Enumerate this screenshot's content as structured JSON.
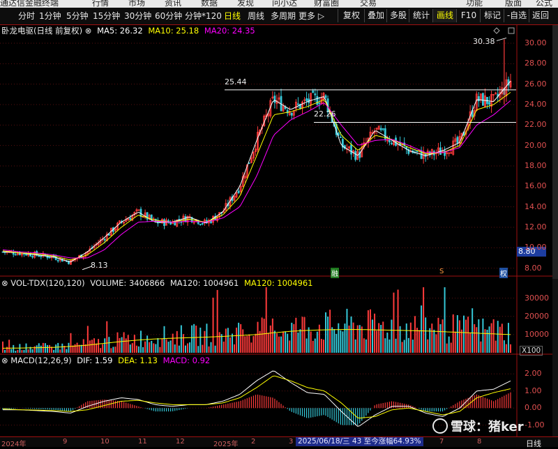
{
  "menubar": {
    "items": [
      "通达信金融终端",
      "行情",
      "市场",
      "资讯",
      "数据",
      "发现",
      "问小达",
      "财富圈",
      "交易",
      "功能",
      "版面",
      "公式"
    ]
  },
  "toolbar": {
    "periods": [
      "分时",
      "1分钟",
      "5分钟",
      "15分钟",
      "30分钟",
      "60分钟",
      "分钟*120",
      "日线",
      "周线",
      "多周期",
      "更多 ▷"
    ],
    "active_period": "日线",
    "right_buttons": [
      "复权",
      "叠加",
      "多股",
      "统计",
      "画线",
      "F10",
      "标记",
      "-自选",
      "返回"
    ],
    "active_right": "画线"
  },
  "main_chart": {
    "stock_title": "卧龙电驱(日线 前复权)",
    "ma5_label": "MA5: 26.32",
    "ma10_label": "MA10: 25.18",
    "ma20_label": "MA20: 24.35",
    "colors": {
      "ma5": "#ffffff",
      "ma10": "#ffff00",
      "ma20": "#ff00ff",
      "up": "#ff3b3b",
      "down": "#35c8d8"
    },
    "annotations": {
      "high": "30.38",
      "line1": "25.44",
      "line2": "22.26",
      "low": "8.13",
      "current_price": "8.80"
    },
    "event_marks": [
      "融",
      "S",
      "权"
    ]
  },
  "volume_chart": {
    "title": "VOL-TDX(120,120)",
    "volume_label": "VOLUME: 3406866",
    "ma120_label": "MA120: 1004961",
    "ma120b_label": "MA120: 1004961",
    "unit": "X100"
  },
  "macd_chart": {
    "title": "MACD(12,26,9)",
    "dif_label": "DIF: 1.59",
    "dea_label": "DEA: 1.13",
    "macd_label": "MACD: 0.92"
  },
  "chart_data": [
    {
      "type": "line",
      "title": "卧龙电驱(日线 前复权)",
      "y_ticks": [
        8.0,
        10.0,
        12.0,
        14.0,
        16.0,
        18.0,
        20.0,
        22.0,
        24.0,
        26.0,
        28.0,
        30.0
      ],
      "ylim": [
        7.5,
        31.5
      ],
      "x_month_labels": [
        "2024年",
        "9",
        "10",
        "11",
        "12",
        "2025年",
        "2",
        "3",
        "4",
        "5",
        "6",
        "7",
        "8"
      ],
      "series": [
        {
          "name": "MA5",
          "values": [
            9.6,
            9.5,
            9.3,
            9.1,
            8.6,
            9.6,
            11.0,
            12.5,
            13.5,
            12.5,
            12.5,
            13.0,
            12.4,
            13.5,
            16.0,
            20.5,
            24.5,
            23.5,
            24.3,
            24.8,
            20.0,
            19.0,
            21.5,
            20.5,
            19.5,
            19.0,
            19.5,
            20.3,
            24.5,
            24.3,
            26.3
          ]
        },
        {
          "name": "MA10",
          "values": [
            9.7,
            9.5,
            9.4,
            9.2,
            8.8,
            9.3,
            10.5,
            12.0,
            13.2,
            12.7,
            12.5,
            12.8,
            12.5,
            13.2,
            15.0,
            19.0,
            23.0,
            23.3,
            23.8,
            24.5,
            21.0,
            19.5,
            21.0,
            20.6,
            19.8,
            19.2,
            19.3,
            20.0,
            23.5,
            24.0,
            25.2
          ]
        },
        {
          "name": "MA20",
          "values": [
            9.8,
            9.6,
            9.5,
            9.3,
            9.0,
            9.0,
            9.8,
            11.3,
            12.5,
            12.6,
            12.5,
            12.6,
            12.5,
            12.9,
            14.0,
            17.0,
            21.0,
            22.5,
            23.3,
            24.2,
            22.0,
            20.0,
            20.5,
            20.6,
            20.0,
            19.3,
            19.3,
            19.8,
            22.0,
            23.0,
            24.4
          ]
        }
      ],
      "high_label": 30.38,
      "low_label": 8.13,
      "horizontal_lines": [
        25.44,
        22.26
      ],
      "current_price": 8.8
    },
    {
      "type": "bar",
      "title": "VOL-TDX(120,120)",
      "y_ticks": [
        10000,
        20000,
        30000
      ],
      "ylim": [
        0,
        36000
      ],
      "ma120": [
        2500,
        2600,
        2800,
        3000,
        3500,
        4200,
        5200,
        6200,
        7000,
        7600,
        8000,
        8300,
        8600,
        9000,
        9500,
        10000,
        11000,
        11800,
        12300,
        12600,
        12800,
        12800,
        12600,
        12400,
        12200,
        12000,
        11600,
        11200,
        10800,
        10400,
        10000
      ]
    },
    {
      "type": "line",
      "title": "MACD(12,26,9)",
      "y_ticks": [
        -1.0,
        0.0,
        1.0,
        2.0
      ],
      "ylim": [
        -1.5,
        2.5
      ],
      "series": [
        {
          "name": "DIF",
          "values": [
            -0.1,
            -0.1,
            -0.15,
            -0.2,
            -0.3,
            0.1,
            0.4,
            0.6,
            0.5,
            0.2,
            0.1,
            0.2,
            0.2,
            0.4,
            0.8,
            1.6,
            2.2,
            1.5,
            0.9,
            0.8,
            -0.2,
            -1.1,
            -0.4,
            0.1,
            0.1,
            -0.3,
            -0.5,
            0.0,
            1.0,
            1.1,
            1.59
          ]
        },
        {
          "name": "DEA",
          "values": [
            -0.05,
            -0.1,
            -0.12,
            -0.15,
            -0.2,
            -0.1,
            0.15,
            0.4,
            0.45,
            0.3,
            0.2,
            0.2,
            0.2,
            0.3,
            0.6,
            1.2,
            1.9,
            1.6,
            1.2,
            1.0,
            0.3,
            -0.6,
            -0.5,
            -0.1,
            0.0,
            -0.2,
            -0.4,
            -0.2,
            0.6,
            0.9,
            1.13
          ]
        }
      ],
      "macd_bar_end": 0.92
    }
  ],
  "watermark": {
    "text": "雪球：猪ker"
  },
  "status_note": "2025/06/18/三 43 至今涨幅64.93%",
  "datebar": {
    "right_label": "日线"
  }
}
